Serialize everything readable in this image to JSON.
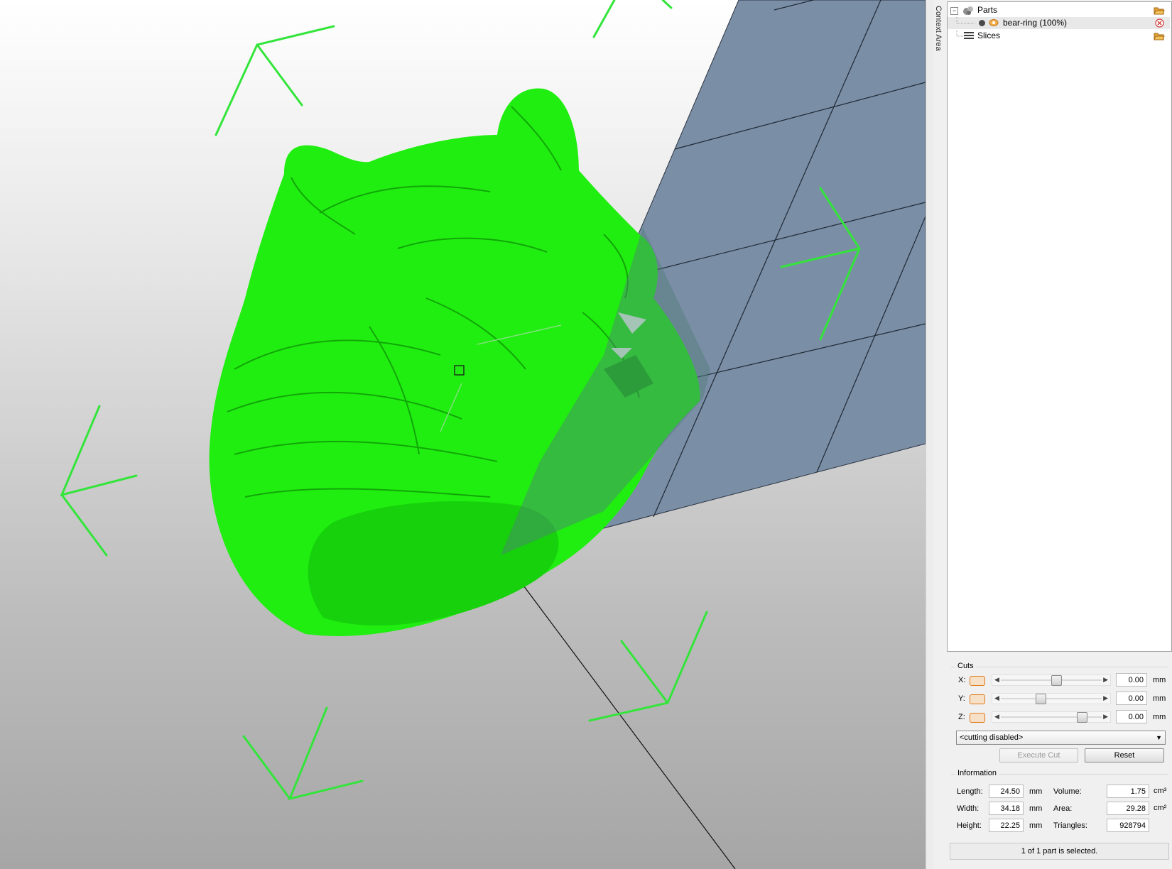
{
  "sidebar": {
    "context_tab": "Context Area",
    "tree": {
      "parts_label": "Parts",
      "part_item_label": "bear-ring (100%)",
      "slices_label": "Slices"
    }
  },
  "cuts": {
    "title": "Cuts",
    "x_label": "X:",
    "y_label": "Y:",
    "z_label": "Z:",
    "x_value": "0.00",
    "y_value": "0.00",
    "z_value": "0.00",
    "unit": "mm",
    "slider_positions": [
      0.55,
      0.38,
      0.83
    ],
    "mode_selected": "<cutting disabled>",
    "execute_label": "Execute Cut",
    "reset_label": "Reset"
  },
  "information": {
    "title": "Information",
    "length_label": "Length:",
    "length_value": "24.50",
    "width_label": "Width:",
    "width_value": "34.18",
    "height_label": "Height:",
    "height_value": "22.25",
    "unit_mm": "mm",
    "volume_label": "Volume:",
    "volume_value": "1.75",
    "area_label": "Area:",
    "area_value": "29.28",
    "triangles_label": "Triangles:",
    "triangles_value": "928794",
    "unit_cm3": "cm³",
    "unit_cm2": "cm²"
  },
  "status_text": "1 of 1 part is selected.",
  "colors": {
    "model_green": "#20ee10",
    "gizmo_green": "#33e53a",
    "cut_plane": "#7a8ea6",
    "accent_orange": "#e07a1a"
  },
  "icons": [
    "parts-icon",
    "visibility-dot-icon",
    "part-eye-icon",
    "slices-icon",
    "open-folder-icon",
    "remove-icon",
    "expand-icon"
  ]
}
